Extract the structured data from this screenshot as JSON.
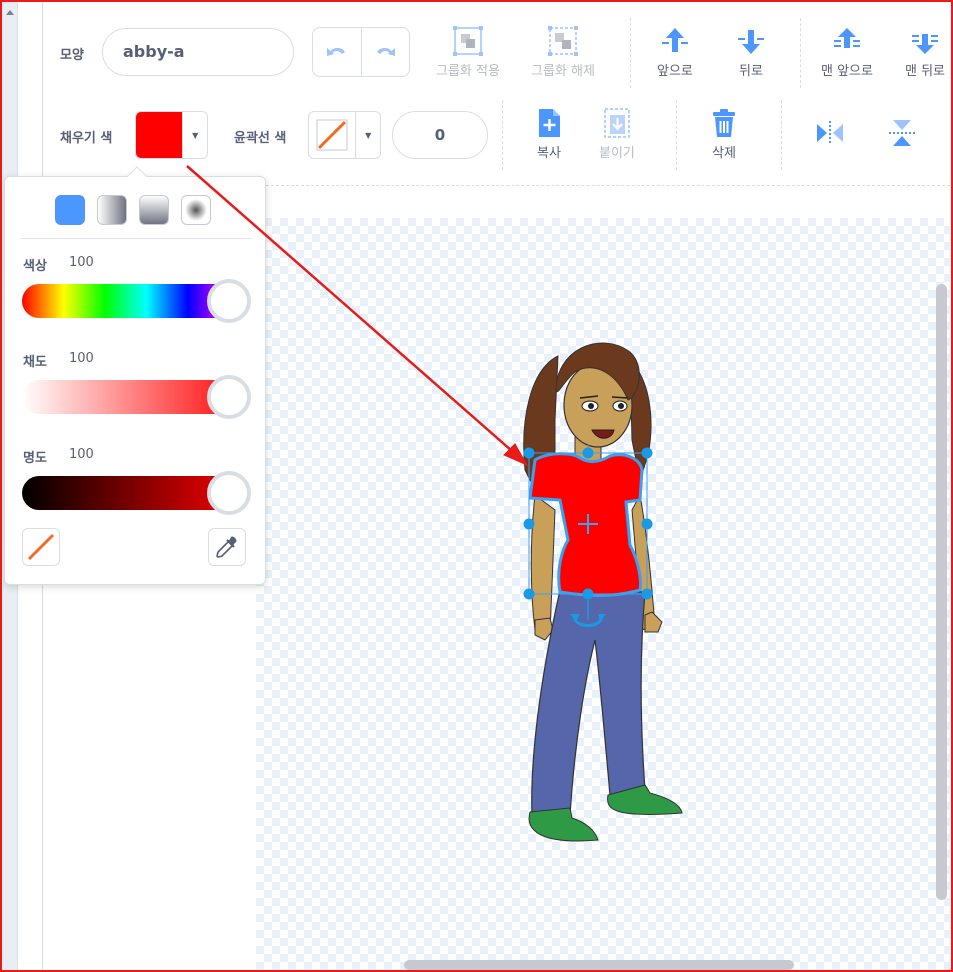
{
  "toolbar": {
    "costume_label": "모양",
    "costume_name": "abby-a",
    "group_label": "그룹화 적용",
    "ungroup_label": "그룹화 해제",
    "forward_label": "앞으로",
    "backward_label": "뒤로",
    "front_label": "맨 앞으로",
    "back_label": "맨 뒤로",
    "fill_label": "채우기 색",
    "outline_label": "윤곽선 색",
    "outline_width": "0",
    "copy_label": "복사",
    "paste_label": "붙이기",
    "delete_label": "삭제"
  },
  "fill_color": "#ff0000",
  "accent_color": "#4c97ff",
  "annotation_color": "#e81a1a",
  "color_picker": {
    "hue_label": "색상",
    "hue_value": "100",
    "saturation_label": "채도",
    "saturation_value": "100",
    "brightness_label": "명도",
    "brightness_value": "100",
    "modes": [
      "solid",
      "horizontal-gradient",
      "vertical-gradient",
      "radial-gradient"
    ],
    "selected_mode": "solid"
  }
}
